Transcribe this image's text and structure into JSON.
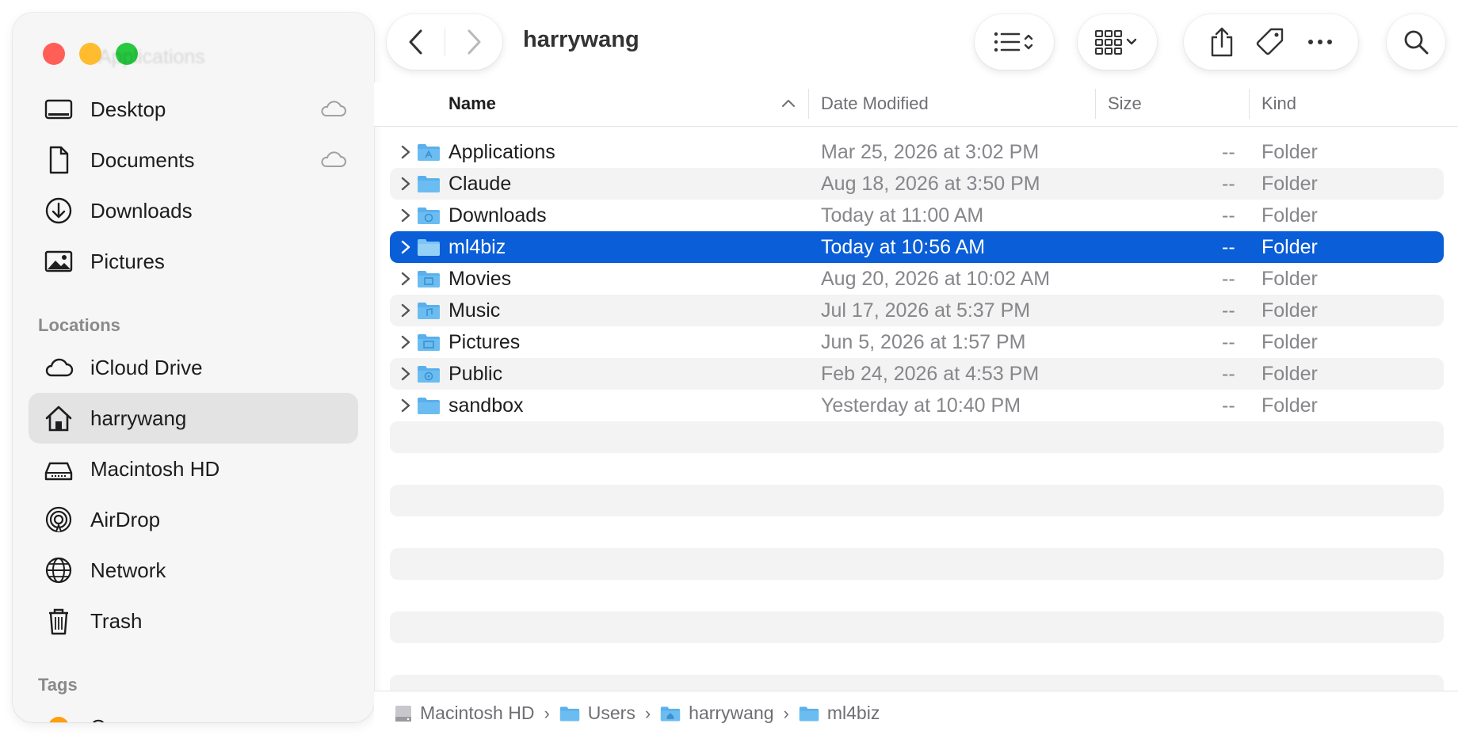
{
  "window": {
    "title": "harrywang",
    "ghost_title": "Applications"
  },
  "sidebar": {
    "favorites": [
      {
        "label": "Desktop",
        "icon": "desktop-icon",
        "cloud": true
      },
      {
        "label": "Documents",
        "icon": "document-icon",
        "cloud": true
      },
      {
        "label": "Downloads",
        "icon": "download-icon",
        "cloud": false
      },
      {
        "label": "Pictures",
        "icon": "pictures-icon",
        "cloud": false
      }
    ],
    "locations_header": "Locations",
    "locations": [
      {
        "label": "iCloud Drive",
        "icon": "cloud-icon"
      },
      {
        "label": "harrywang",
        "icon": "home-icon",
        "active": true
      },
      {
        "label": "Macintosh HD",
        "icon": "drive-icon"
      },
      {
        "label": "AirDrop",
        "icon": "airdrop-icon"
      },
      {
        "label": "Network",
        "icon": "globe-icon"
      },
      {
        "label": "Trash",
        "icon": "trash-icon"
      }
    ],
    "tags_header": "Tags",
    "tags": [
      {
        "label": "Orange",
        "color": "#ff9f0a"
      }
    ]
  },
  "columns": {
    "name": "Name",
    "date": "Date Modified",
    "size": "Size",
    "kind": "Kind"
  },
  "files": [
    {
      "name": "Applications",
      "date": "Mar 25, 2026 at 3:02 PM",
      "size": "--",
      "kind": "Folder"
    },
    {
      "name": "Claude",
      "date": "Aug 18, 2026 at 3:50 PM",
      "size": "--",
      "kind": "Folder"
    },
    {
      "name": "Downloads",
      "date": "Today at 11:00 AM",
      "size": "--",
      "kind": "Folder"
    },
    {
      "name": "ml4biz",
      "date": "Today at 10:56 AM",
      "size": "--",
      "kind": "Folder",
      "selected": true
    },
    {
      "name": "Movies",
      "date": "Aug 20, 2026 at 10:02 AM",
      "size": "--",
      "kind": "Folder"
    },
    {
      "name": "Music",
      "date": "Jul 17, 2026 at 5:37 PM",
      "size": "--",
      "kind": "Folder"
    },
    {
      "name": "Pictures",
      "date": "Jun 5, 2026 at 1:57 PM",
      "size": "--",
      "kind": "Folder"
    },
    {
      "name": "Public",
      "date": "Feb 24, 2026 at 4:53 PM",
      "size": "--",
      "kind": "Folder"
    },
    {
      "name": "sandbox",
      "date": "Yesterday at 10:40 PM",
      "size": "--",
      "kind": "Folder"
    }
  ],
  "pathbar": [
    "Macintosh HD",
    "Users",
    "harrywang",
    "ml4biz"
  ],
  "colors": {
    "selection": "#0a5ed7",
    "folder": "#5ab0ec",
    "tag_orange": "#ff9f0a"
  }
}
